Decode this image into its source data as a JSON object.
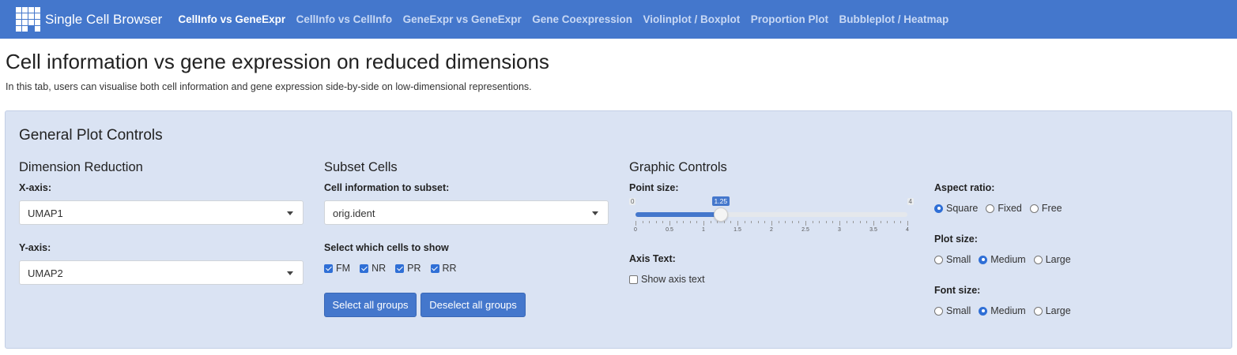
{
  "app": {
    "brand": "Single Cell Browser",
    "nav": [
      {
        "label": "CellInfo vs GeneExpr",
        "active": true
      },
      {
        "label": "CellInfo vs CellInfo",
        "active": false
      },
      {
        "label": "GeneExpr vs GeneExpr",
        "active": false
      },
      {
        "label": "Gene Coexpression",
        "active": false
      },
      {
        "label": "Violinplot / Boxplot",
        "active": false
      },
      {
        "label": "Proportion Plot",
        "active": false
      },
      {
        "label": "Bubbleplot / Heatmap",
        "active": false
      }
    ]
  },
  "header": {
    "title": "Cell information vs gene expression on reduced dimensions",
    "description": "In this tab, users can visualise both cell information and gene expression side-by-side on low-dimensional representions."
  },
  "controls": {
    "title": "General Plot Controls",
    "dimension_reduction": {
      "title": "Dimension Reduction",
      "x_label": "X-axis:",
      "x_value": "UMAP1",
      "y_label": "Y-axis:",
      "y_value": "UMAP2"
    },
    "subset": {
      "title": "Subset Cells",
      "info_label": "Cell information to subset:",
      "info_value": "orig.ident",
      "cells_label": "Select which cells to show",
      "groups": [
        {
          "label": "FM",
          "checked": true
        },
        {
          "label": "NR",
          "checked": true
        },
        {
          "label": "PR",
          "checked": true
        },
        {
          "label": "RR",
          "checked": true
        }
      ],
      "select_all": "Select all groups",
      "deselect_all": "Deselect all groups"
    },
    "graphic": {
      "title": "Graphic Controls",
      "point_size_label": "Point size:",
      "point_size": {
        "min": 0,
        "max": 4,
        "value": 1.25,
        "value_label": "1.25",
        "min_label": "0",
        "max_label": "4",
        "ticks": [
          "0",
          "0.5",
          "1",
          "1.5",
          "2",
          "2.5",
          "3",
          "3.5",
          "4"
        ]
      },
      "axis_text_label": "Axis Text:",
      "show_axis_text": {
        "label": "Show axis text",
        "checked": false
      }
    },
    "aspect": {
      "aspect_label": "Aspect ratio:",
      "aspect_options": [
        {
          "label": "Square",
          "selected": true
        },
        {
          "label": "Fixed",
          "selected": false
        },
        {
          "label": "Free",
          "selected": false
        }
      ],
      "plot_size_label": "Plot size:",
      "plot_size_options": [
        {
          "label": "Small",
          "selected": false
        },
        {
          "label": "Medium",
          "selected": true
        },
        {
          "label": "Large",
          "selected": false
        }
      ],
      "font_size_label": "Font size:",
      "font_size_options": [
        {
          "label": "Small",
          "selected": false
        },
        {
          "label": "Medium",
          "selected": true
        },
        {
          "label": "Large",
          "selected": false
        }
      ]
    }
  }
}
